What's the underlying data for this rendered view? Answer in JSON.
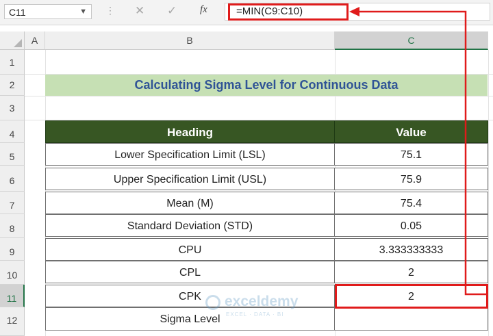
{
  "formula_bar": {
    "name_box": "C11",
    "cancel_glyph": "✕",
    "enter_glyph": "✓",
    "fx_label": "fx",
    "formula": "=MIN(C9:C10)"
  },
  "columns": [
    "A",
    "B",
    "C"
  ],
  "rows": [
    "1",
    "2",
    "3",
    "4",
    "5",
    "6",
    "7",
    "8",
    "9",
    "10",
    "11",
    "12"
  ],
  "sheet": {
    "title": "Calculating Sigma Level for Continuous Data",
    "table": {
      "headers": [
        "Heading",
        "Value"
      ],
      "rows": [
        {
          "heading": "Lower Specification Limit (LSL)",
          "value": "75.1"
        },
        {
          "heading": "Upper Specification Limit (USL)",
          "value": "75.9"
        },
        {
          "heading": "Mean (M)",
          "value": "75.4"
        },
        {
          "heading": "Standard Deviation (STD)",
          "value": "0.05"
        },
        {
          "heading": "CPU",
          "value": "3.333333333"
        },
        {
          "heading": "CPL",
          "value": "2"
        },
        {
          "heading": "CPK",
          "value": "2"
        },
        {
          "heading": "Sigma Level",
          "value": ""
        }
      ]
    }
  },
  "watermark": {
    "brand": "exceldemy",
    "tagline": "EXCEL · DATA · BI"
  },
  "colors": {
    "title_fill": "#c6e0b4",
    "title_text": "#305496",
    "header_fill": "#375623",
    "highlight": "#e01b1b",
    "selection": "#217346"
  }
}
